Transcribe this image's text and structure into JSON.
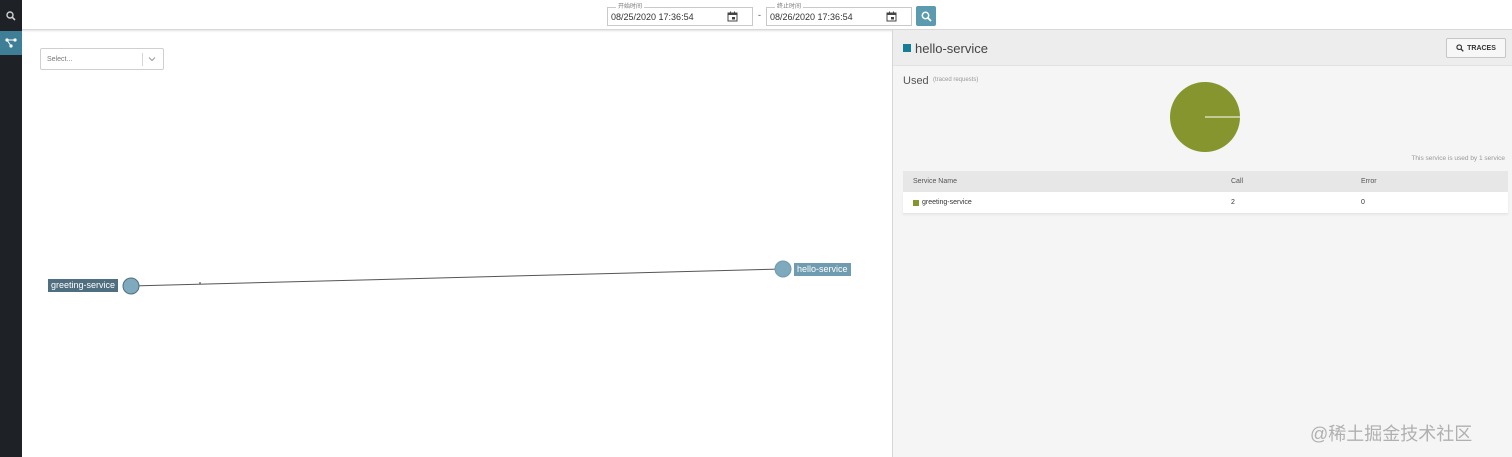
{
  "toolbar": {
    "start_legend": "开始时间",
    "start_value": "08/25/2020 17:36:54",
    "end_legend": "终止时间",
    "end_value": "08/26/2020 17:36:54",
    "range_separator": "-"
  },
  "graph": {
    "select_placeholder": "Select...",
    "nodes": [
      {
        "name": "greeting-service"
      },
      {
        "name": "hello-service"
      }
    ]
  },
  "panel": {
    "service_title": "hello-service",
    "traces_label": "TRACES",
    "used_title": "Used",
    "used_subtitle": "(traced requests)",
    "used_by_note": "This service is used by 1 service",
    "pie_color": "#87952e",
    "table": {
      "headers": [
        "Service Name",
        "Call",
        "Error"
      ],
      "rows": [
        {
          "service": "greeting-service",
          "call": "2",
          "error": "0",
          "color": "#87952e"
        }
      ]
    }
  },
  "watermark": "@稀土掘金技术社区",
  "colors": {
    "accent": "#3e7f97",
    "sidebar_bg": "#1e2226",
    "node_fill": "#7fa9bd"
  },
  "icons": {
    "sidebar_search": "search-icon",
    "sidebar_topology": "topology-icon",
    "calendar": "calendar-icon",
    "search_button": "search-icon",
    "select_chevron": "chevron-down-icon",
    "traces": "search-icon"
  }
}
